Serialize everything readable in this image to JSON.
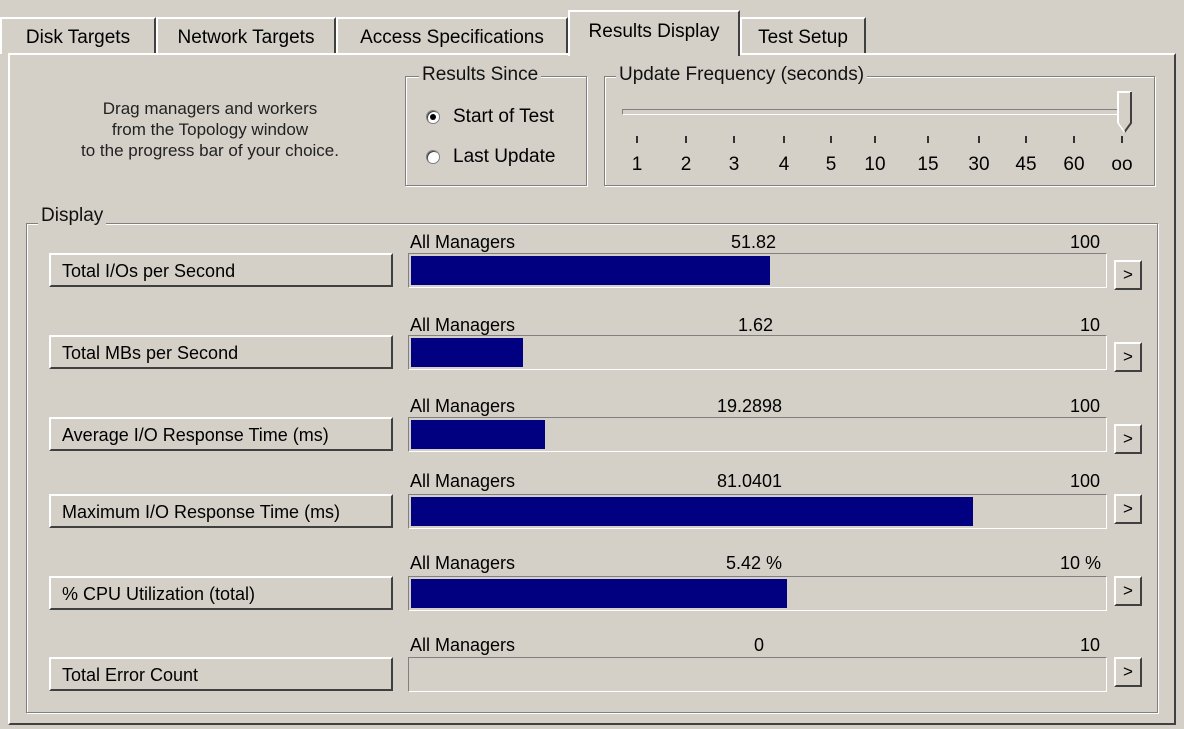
{
  "tabs": [
    {
      "label": "Disk Targets"
    },
    {
      "label": "Network Targets"
    },
    {
      "label": "Access Specifications"
    },
    {
      "label": "Results Display"
    },
    {
      "label": "Test Setup"
    }
  ],
  "active_tab": "Results Display",
  "instructions": {
    "line1": "Drag managers and workers",
    "line2": "from the Topology window",
    "line3": "to the progress bar of your choice."
  },
  "results_since": {
    "title": "Results Since",
    "options": [
      {
        "label": "Start of Test",
        "selected": true
      },
      {
        "label": "Last Update",
        "selected": false
      }
    ]
  },
  "update_frequency": {
    "title": "Update Frequency (seconds)",
    "ticks": [
      "1",
      "2",
      "3",
      "4",
      "5",
      "10",
      "15",
      "30",
      "45",
      "60",
      "oo"
    ],
    "selected": "oo"
  },
  "display": {
    "title": "Display",
    "metrics": [
      {
        "button": "Total I/Os per Second",
        "scope": "All Managers",
        "value": "51.82",
        "max": "100",
        "fill": 0.5182
      },
      {
        "button": "Total MBs per Second",
        "scope": "All Managers",
        "value": "1.62",
        "max": "10",
        "fill": 0.162
      },
      {
        "button": "Average I/O Response Time (ms)",
        "scope": "All Managers",
        "value": "19.2898",
        "max": "100",
        "fill": 0.192898
      },
      {
        "button": "Maximum I/O Response Time (ms)",
        "scope": "All Managers",
        "value": "81.0401",
        "max": "100",
        "fill": 0.810401
      },
      {
        "button": "% CPU Utilization (total)",
        "scope": "All Managers",
        "value": "5.42 %",
        "max": "10 %",
        "fill": 0.542
      },
      {
        "button": "Total Error Count",
        "scope": "All Managers",
        "value": "0",
        "max": "10",
        "fill": 0
      }
    ],
    "arrow_label": ">"
  },
  "colors": {
    "bar_fill": "#000080",
    "face": "#d4d0c8"
  }
}
